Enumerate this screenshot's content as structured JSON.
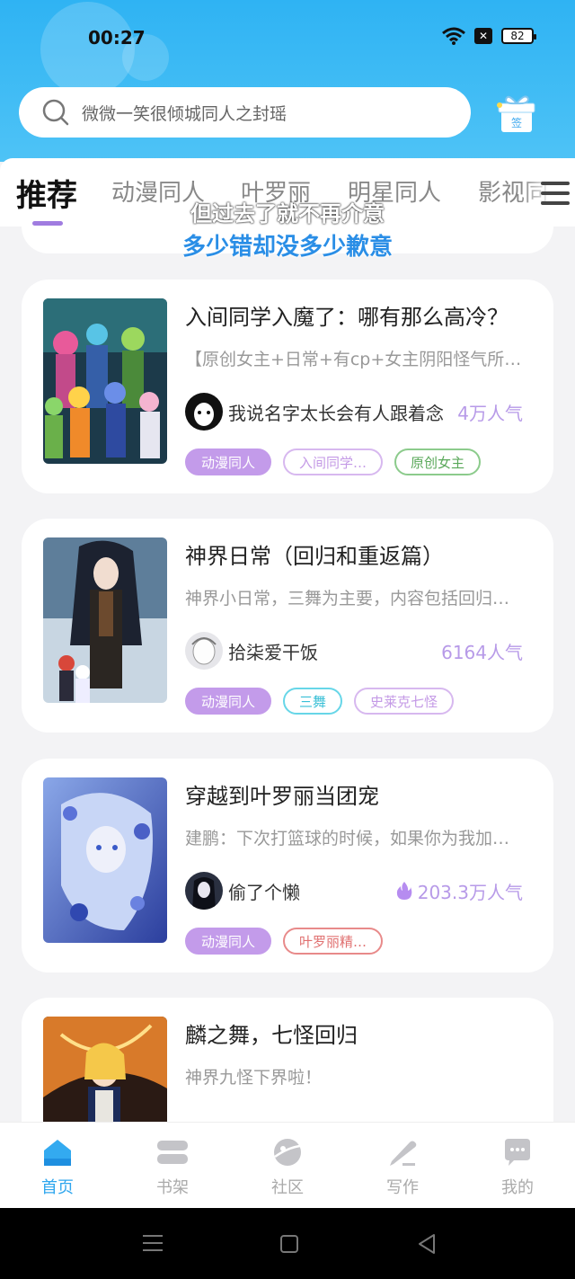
{
  "status_bar": {
    "time": "00:27",
    "battery": "82"
  },
  "search": {
    "placeholder": "微微一笑很倾城同人之封瑶"
  },
  "sign_in": {
    "label": "签"
  },
  "tabs": [
    {
      "label": "推荐",
      "active": true
    },
    {
      "label": "动漫同人"
    },
    {
      "label": "叶罗丽"
    },
    {
      "label": "明星同人"
    },
    {
      "label": "影视同"
    }
  ],
  "subtitle": {
    "line1": "但过去了就不再介意",
    "line2": "多少错却没多少歉意"
  },
  "books": [
    {
      "title": "入间同学入魔了：哪有那么高冷？",
      "description": "【原创女主+日常+有cp+女主阴阳怪气所…",
      "author": "我说名字太长会有人跟着念",
      "popularity": "4万人气",
      "hot": false,
      "tags": [
        {
          "label": "动漫同人",
          "style": "primary"
        },
        {
          "label": "入间同学…",
          "style": "purple"
        },
        {
          "label": "原创女主",
          "style": "green"
        }
      ]
    },
    {
      "title": "神界日常（回归和重返篇）",
      "description": "神界小日常，三舞为主要，内容包括回归…",
      "author": "拾柒爱干饭",
      "popularity": "6164人气",
      "hot": false,
      "tags": [
        {
          "label": "动漫同人",
          "style": "primary"
        },
        {
          "label": "三舞",
          "style": "cyan"
        },
        {
          "label": "史莱克七怪",
          "style": "purple"
        }
      ]
    },
    {
      "title": "穿越到叶罗丽当团宠",
      "description": "建鹏：下次打篮球的时候，如果你为我加…",
      "author": "偷了个懒",
      "popularity": "203.3万人气",
      "hot": true,
      "tags": [
        {
          "label": "动漫同人",
          "style": "primary"
        },
        {
          "label": "叶罗丽精…",
          "style": "pink"
        }
      ]
    },
    {
      "title": "麟之舞，七怪回归",
      "description": "神界九怪下界啦！",
      "author": "",
      "popularity": "",
      "hot": false,
      "tags": []
    }
  ],
  "bottom_nav": [
    {
      "label": "首页",
      "icon": "home-icon",
      "active": true
    },
    {
      "label": "书架",
      "icon": "bookshelf-icon"
    },
    {
      "label": "社区",
      "icon": "community-icon"
    },
    {
      "label": "写作",
      "icon": "write-icon"
    },
    {
      "label": "我的",
      "icon": "profile-icon"
    }
  ],
  "colors": {
    "header": "#2fb3f3",
    "accent": "#a07ce0",
    "popularity": "#b79ae8",
    "nav_active": "#2fa6ee"
  }
}
